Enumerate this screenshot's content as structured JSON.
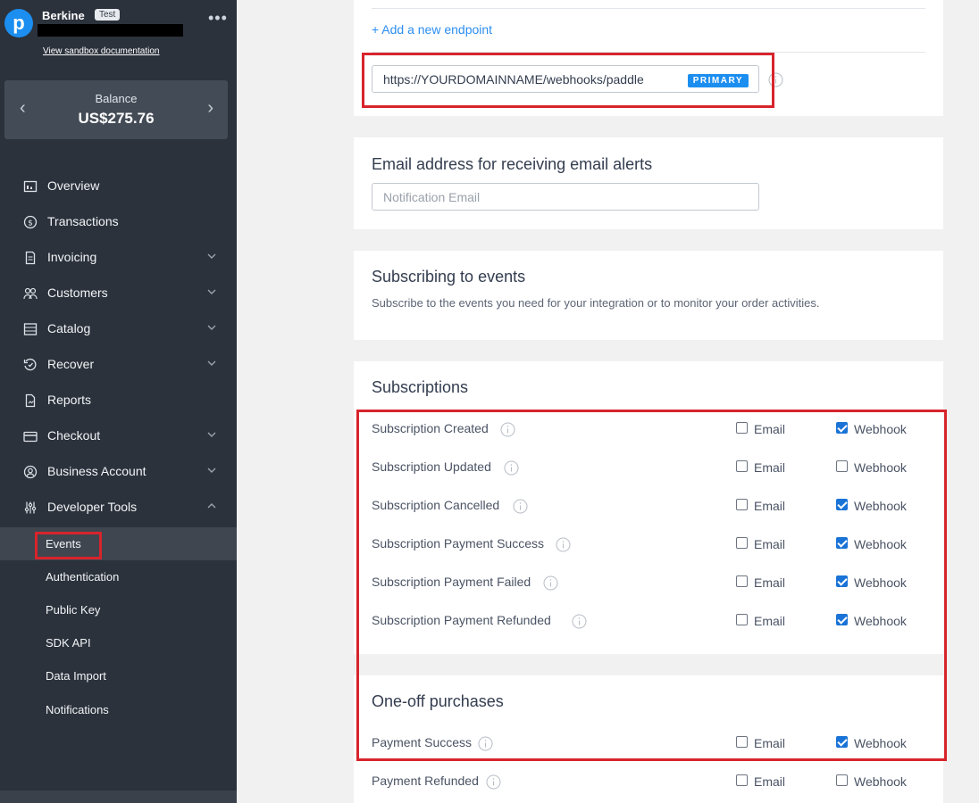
{
  "account": {
    "logo_letter": "p",
    "name": "Berkine",
    "badge": "Test",
    "sandbox_link": "View sandbox documentation",
    "more": "•••"
  },
  "balance": {
    "label": "Balance",
    "value": "US$275.76",
    "prev": "‹",
    "next": "›"
  },
  "nav": [
    {
      "label": "Overview",
      "icon": "chart-icon",
      "expandable": false
    },
    {
      "label": "Transactions",
      "icon": "dollar-icon",
      "expandable": false
    },
    {
      "label": "Invoicing",
      "icon": "invoice-icon",
      "expandable": true
    },
    {
      "label": "Customers",
      "icon": "customers-icon",
      "expandable": true
    },
    {
      "label": "Catalog",
      "icon": "catalog-icon",
      "expandable": true
    },
    {
      "label": "Recover",
      "icon": "recover-icon",
      "expandable": true
    },
    {
      "label": "Reports",
      "icon": "reports-icon",
      "expandable": false
    },
    {
      "label": "Checkout",
      "icon": "checkout-icon",
      "expandable": true
    },
    {
      "label": "Business Account",
      "icon": "account-icon",
      "expandable": true
    },
    {
      "label": "Developer Tools",
      "icon": "developer-tools-icon",
      "expandable": true,
      "expanded": true
    }
  ],
  "dev_tools_sub": [
    "Events",
    "Authentication",
    "Public Key",
    "SDK API",
    "Data Import",
    "Notifications"
  ],
  "active_sub": "Events",
  "endpoint": {
    "add_link": "+ Add a new endpoint",
    "url": "https://YOURDOMAINNAME/webhooks/paddle",
    "badge": "PRIMARY"
  },
  "email_alerts": {
    "title": "Email address for receiving email alerts",
    "placeholder": "Notification Email"
  },
  "subscribing": {
    "title": "Subscribing to events",
    "description": "Subscribe to the events you need for your integration or to monitor your order activities."
  },
  "checkbox_labels": {
    "email": "Email",
    "webhook": "Webhook"
  },
  "subscriptions": {
    "title": "Subscriptions",
    "events": [
      {
        "label": "Subscription Created",
        "email": false,
        "webhook": true
      },
      {
        "label": "Subscription Updated",
        "email": false,
        "webhook": false
      },
      {
        "label": "Subscription Cancelled",
        "email": false,
        "webhook": true
      },
      {
        "label": "Subscription Payment Success",
        "email": false,
        "webhook": true
      },
      {
        "label": "Subscription Payment Failed",
        "email": false,
        "webhook": true
      },
      {
        "label": "Subscription Payment Refunded",
        "email": false,
        "webhook": true
      }
    ]
  },
  "one_off": {
    "title": "One-off purchases",
    "events": [
      {
        "label": "Payment Success",
        "email": false,
        "webhook": true
      },
      {
        "label": "Payment Refunded",
        "email": false,
        "webhook": false
      }
    ]
  },
  "colors": {
    "sidebar": "#2b323c",
    "accent": "#1c8ef0",
    "highlight": "#d8242c"
  }
}
